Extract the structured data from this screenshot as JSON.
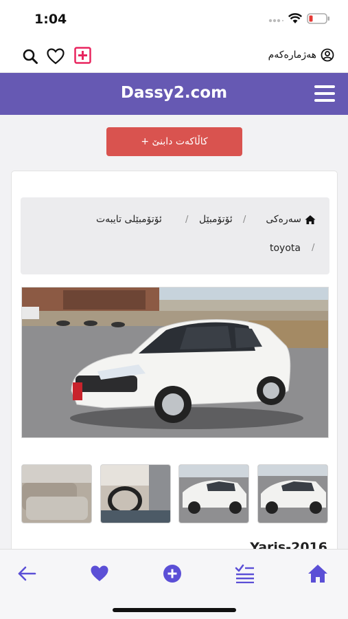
{
  "status_bar": {
    "time": "1:04"
  },
  "top_bar": {
    "account_label": "هەژمارەکەم",
    "icons": [
      "search-icon",
      "heart-icon",
      "add-box-icon",
      "user-circle-icon"
    ]
  },
  "header": {
    "site_title": "Dassy2.com",
    "menu_icon": "hamburger-icon"
  },
  "actions": {
    "post_ad_label": "+ کاڵاکەت دابنێ"
  },
  "breadcrumb": {
    "home": "سەرەکی",
    "separator": "/",
    "cars": "ئۆتۆمبێل",
    "private_cars": "ئۆتۆمبێلی تایبەت",
    "brand": "toyota"
  },
  "listing": {
    "title": "Yaris-2016",
    "thumbnails": [
      "thumbnail-interior-seats",
      "thumbnail-steering-wheel",
      "thumbnail-car-side",
      "thumbnail-car-side-alt"
    ]
  },
  "bottom_nav": {
    "items": [
      "back-arrow-icon",
      "favorites-icon",
      "add-circle-icon",
      "my-ads-icon",
      "home-icon"
    ]
  },
  "colors": {
    "brand_purple": "#6659b3",
    "accent_red": "#d9534f",
    "nav_purple": "#5b4fd6",
    "add_pink": "#e8255f"
  }
}
